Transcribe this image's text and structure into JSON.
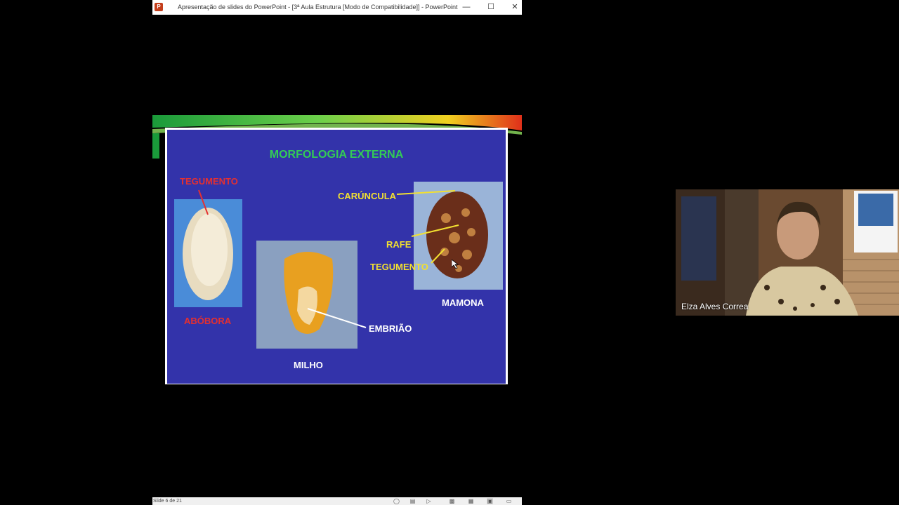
{
  "window": {
    "app_icon": "powerpoint-icon",
    "title": "Apresentação de slides do PowerPoint - [3ª Aula Estrutura [Modo de Compatibilidade]] - PowerPoint",
    "controls": [
      "minimize-icon",
      "maximize-icon",
      "close-icon"
    ]
  },
  "slide": {
    "title": "MORFOLOGIA EXTERNA",
    "labels": {
      "tegumento_aborora": "TEGUMENTO",
      "aborora": "ABÓBORA",
      "milho": "MILHO",
      "embriao": "EMBRIÃO",
      "caruncula": "CARÚNCULA",
      "rafe": "RAFE",
      "tegumento_mamona": "TEGUMENTO",
      "mamona": "MAMONA"
    },
    "colors": {
      "background": "#3333aa",
      "title": "#33cc55",
      "red_label": "#e53030",
      "yellow_label": "#f2e030"
    }
  },
  "statusbar": {
    "slide_counter": "Slide 6 de 21",
    "icons": [
      "accessibility-icon",
      "notes-icon",
      "comments-icon",
      "normal-view-icon",
      "slide-sorter-icon",
      "reading-view-icon",
      "slideshow-icon"
    ]
  },
  "video": {
    "participant_name": "Elza Alves Correa"
  }
}
